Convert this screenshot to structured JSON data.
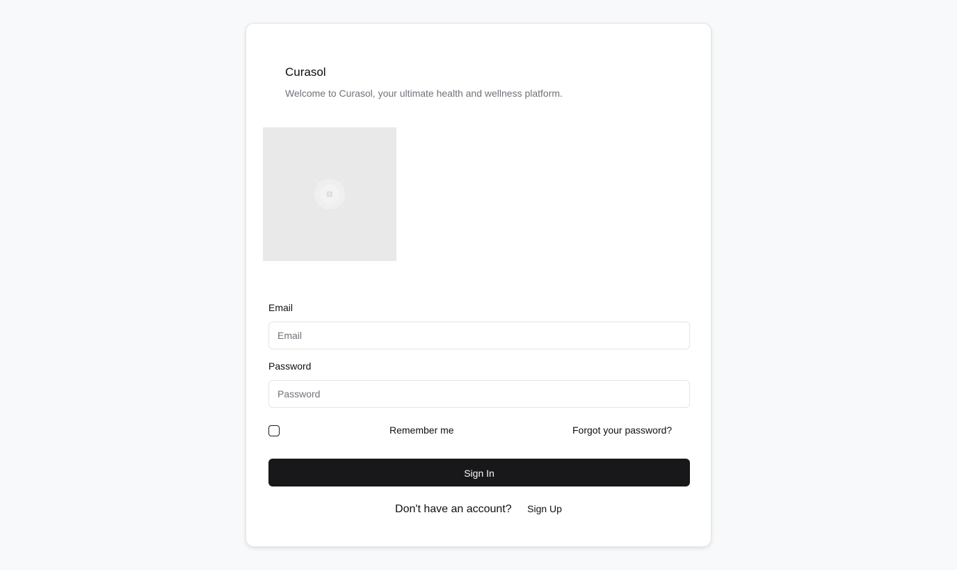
{
  "brand": {
    "title": "Curasol",
    "subtitle": "Welcome to Curasol, your ultimate health and wellness platform."
  },
  "form": {
    "email_label": "Email",
    "email_placeholder": "Email",
    "email_value": "",
    "password_label": "Password",
    "password_placeholder": "Password",
    "password_value": "",
    "remember_label": "Remember me",
    "remember_checked": false,
    "forgot_label": "Forgot your password?",
    "submit_label": "Sign In"
  },
  "footer": {
    "prompt": "Don't have an account?",
    "signup_label": "Sign Up"
  },
  "colors": {
    "background": "#f8f9fa",
    "card": "#ffffff",
    "primary_button": "#18181b",
    "muted_text": "#71717a",
    "image_placeholder": "#e9e9e9"
  },
  "icons": {
    "hero_image": "image-placeholder-icon"
  }
}
